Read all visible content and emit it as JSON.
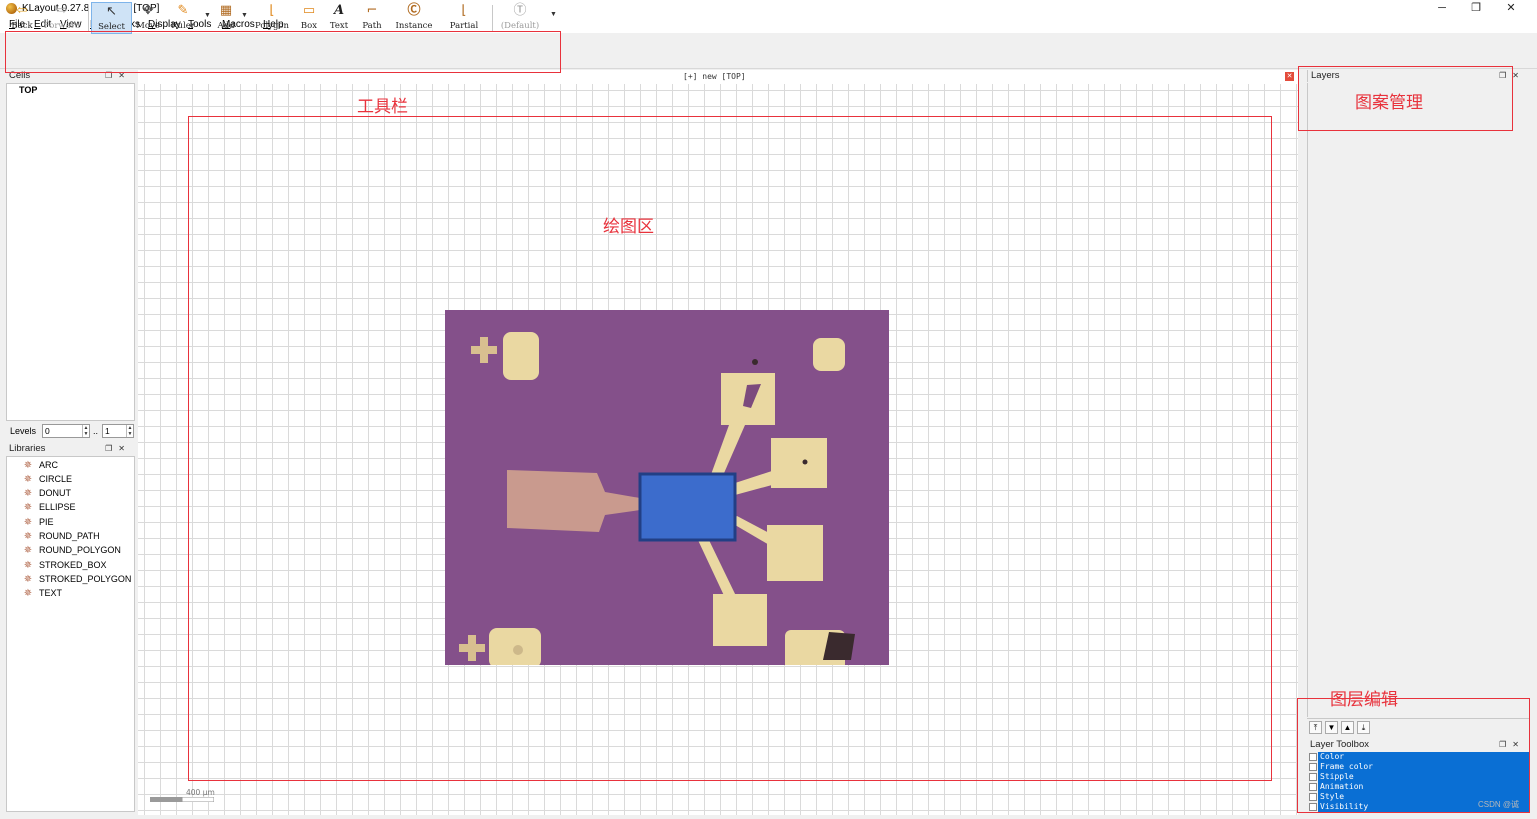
{
  "window": {
    "title": "KLayout 0.27.8 - [+] new [TOP]",
    "min": "─",
    "restore": "❐",
    "close": "✕"
  },
  "menu": [
    "File",
    "Edit",
    "View",
    "Bookmarks",
    "Display",
    "Tools",
    "Macros",
    "Help"
  ],
  "toolbar": {
    "back": "Back",
    "forward": "Forward",
    "select": "Select",
    "move": "Move",
    "ruler": "Ruler",
    "add": "Add",
    "polygon": "Polygon",
    "box": "Box",
    "text": "Text",
    "path": "Path",
    "instance": "Instance",
    "partial": "Partial",
    "default": "(Default)"
  },
  "cells": {
    "title": "Cells",
    "items": [
      "TOP"
    ]
  },
  "levels": {
    "label": "Levels",
    "from": "0",
    "sep": "..",
    "to": "1"
  },
  "libraries": {
    "title": "Libraries",
    "items": [
      "ARC",
      "CIRCLE",
      "DONUT",
      "ELLIPSE",
      "PIE",
      "ROUND_PATH",
      "ROUND_POLYGON",
      "STROKED_BOX",
      "STROKED_POLYGON",
      "TEXT"
    ]
  },
  "canvas": {
    "title": "[+] new [TOP]",
    "scale": "400 μm"
  },
  "layers": {
    "title": "Layers"
  },
  "layer_toolbox": {
    "title": "Layer Toolbox",
    "rows": [
      "Color",
      "Frame color",
      "Stipple",
      "Animation",
      "Style",
      "Visibility"
    ]
  },
  "annotations": {
    "toolbar": "工具栏",
    "drawing_area": "绘图区",
    "pattern_mgmt": "图案管理",
    "layer_edit": "图层编辑"
  },
  "watermark": "CSDN @诚",
  "colors": {
    "highlight": "#e8323c",
    "selection": "#0a6fd4",
    "substrate": "#84508a",
    "gold_pad": "#ead8a2",
    "device": "#3c6ccc"
  }
}
